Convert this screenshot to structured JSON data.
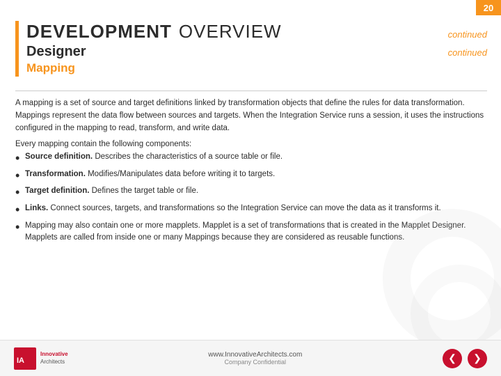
{
  "page": {
    "number": "20",
    "title_bold": "DEVELOPMENT",
    "title_light": "OVERVIEW",
    "continued_top": "continued",
    "subtitle": "Designer",
    "continued_bottom": "continued",
    "section": "Mapping"
  },
  "content": {
    "intro": "A mapping is a set of source and target definitions linked by transformation objects that define the rules for data transformation. Mappings represent the data flow between sources and targets. When the Integration Service runs a session, it uses the instructions configured in the mapping to read, transform, and write data.",
    "components_label": "Every mapping contain the following components:",
    "bullets": [
      {
        "term": "Source definition.",
        "text": " Describes the characteristics of a source table or file."
      },
      {
        "term": "Transformation.",
        "text": " Modifies/Manipulates data before writing it to targets."
      },
      {
        "term": "Target definition.",
        "text": " Defines the target table or file."
      },
      {
        "term": "Links.",
        "text": " Connect sources, targets, and transformations so the Integration Service can move the data as it transforms it."
      },
      {
        "term": "",
        "text": "Mapping may also contain one or more mapplets. Mapplet is a set of transformations that is created in the Mapplet Designer. Mapplets are called from inside one or many Mappings because they are considered as reusable functions."
      }
    ]
  },
  "footer": {
    "url": "www.InnovativeArchitects.com",
    "confidential": "Company Confidential",
    "prev_icon": "❮",
    "next_icon": "❯"
  }
}
